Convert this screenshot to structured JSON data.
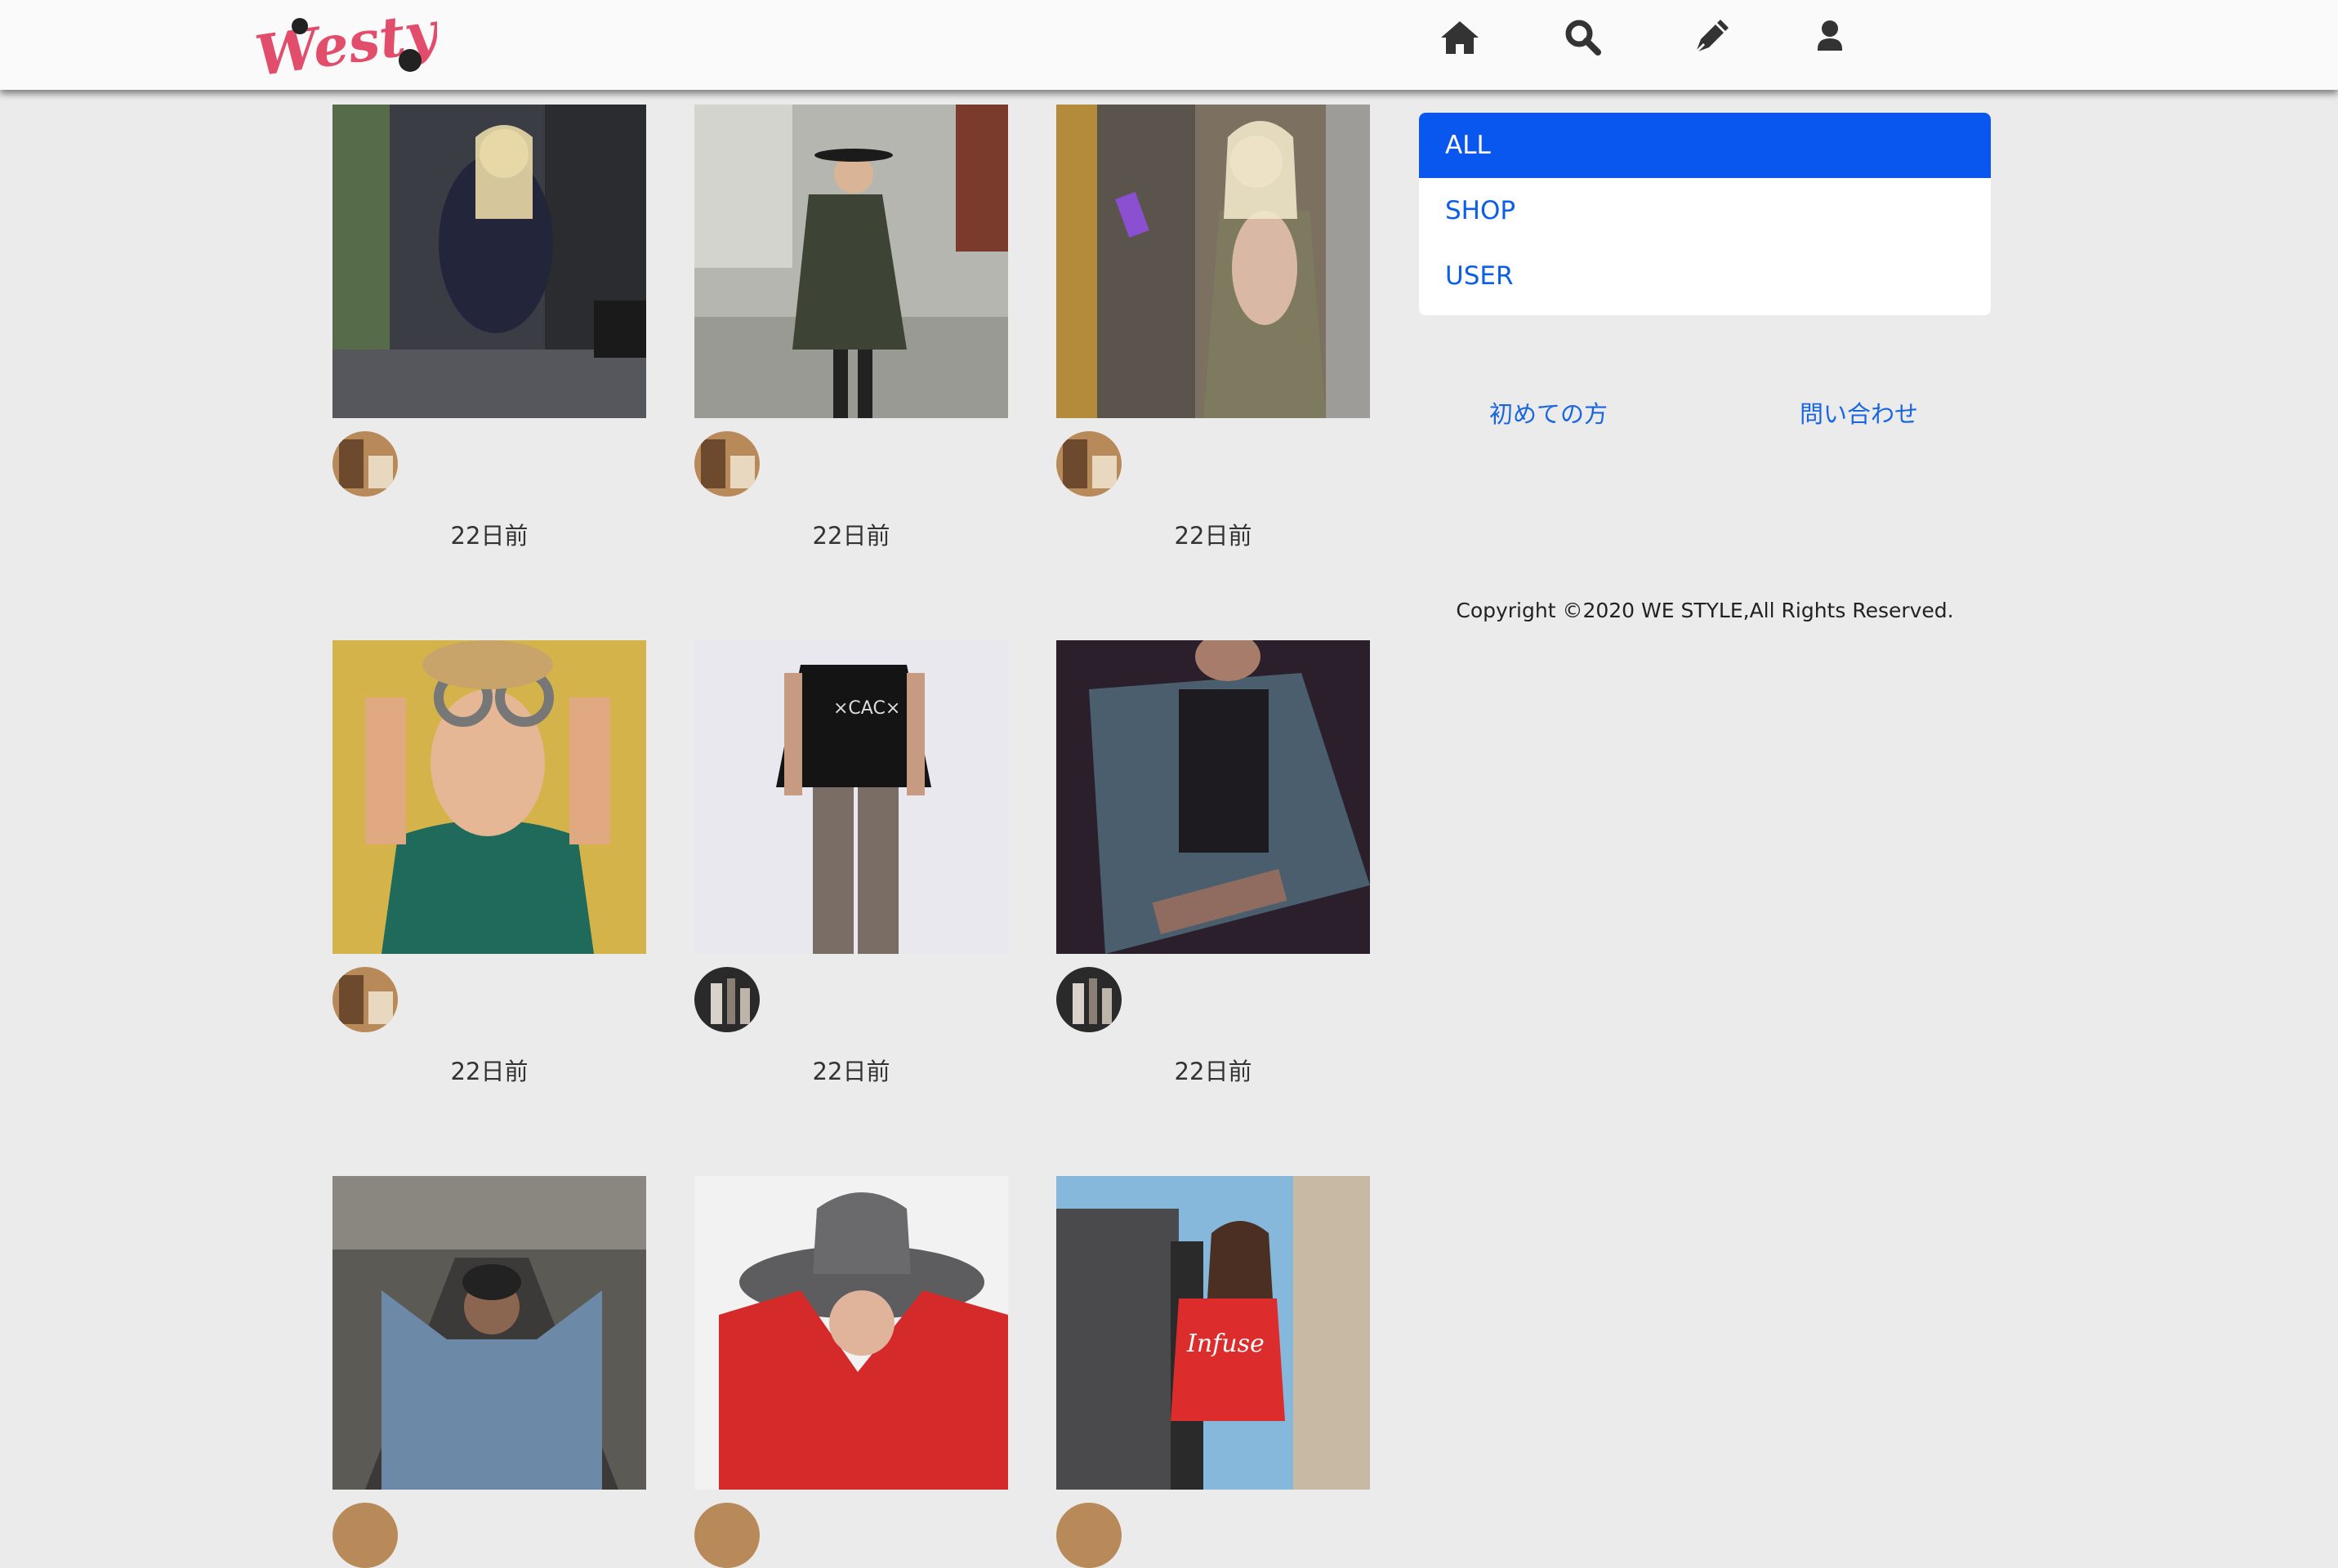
{
  "app": {
    "logo_text": "Westyle",
    "accent_color": "#0a57f0",
    "logo_color": "#e34d6c"
  },
  "nav": [
    {
      "icon": "home-icon"
    },
    {
      "icon": "search-icon"
    },
    {
      "icon": "pen-icon"
    },
    {
      "icon": "user-icon"
    }
  ],
  "posts": [
    {
      "time": "22日前"
    },
    {
      "time": "22日前"
    },
    {
      "time": "22日前"
    },
    {
      "time": "22日前"
    },
    {
      "time": "22日前"
    },
    {
      "time": "22日前"
    },
    {
      "time": ""
    },
    {
      "time": ""
    },
    {
      "time": ""
    }
  ],
  "sidebar": {
    "filters": [
      {
        "label": "ALL",
        "active": true
      },
      {
        "label": "SHOP",
        "active": false
      },
      {
        "label": "USER",
        "active": false
      }
    ],
    "links": {
      "first_time": "初めての方",
      "contact": "問い合わせ"
    },
    "copyright": "Copyright ©2020 WE STYLE,All Rights Reserved."
  }
}
